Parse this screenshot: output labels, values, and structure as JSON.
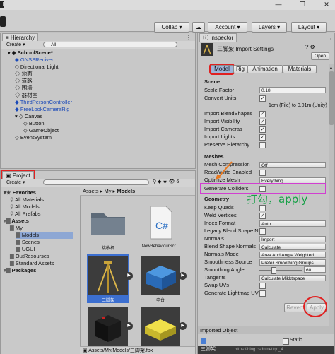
{
  "window": {
    "minimize": "—",
    "maximize": "❐",
    "close": "✕"
  },
  "toolbar": {
    "collab": "Collab ▾",
    "cloud": "☁",
    "account": "Account ▾",
    "layers": "Layers ▾",
    "layout": "Layout ▾"
  },
  "hierarchy": {
    "tab": "Hierarchy",
    "create": "Create ▾",
    "search_placeholder": "All",
    "scene": "SchoolScene*",
    "items": [
      {
        "label": "GNSSReciver",
        "blue": true,
        "indent": 1
      },
      {
        "label": "Directional Light",
        "blue": false,
        "indent": 1
      },
      {
        "label": "地面",
        "blue": false,
        "indent": 1
      },
      {
        "label": "道路",
        "blue": false,
        "indent": 1
      },
      {
        "label": "围墙",
        "blue": false,
        "indent": 1
      },
      {
        "label": "器材室",
        "blue": false,
        "indent": 1
      },
      {
        "label": "ThirdPersonController",
        "blue": true,
        "indent": 1
      },
      {
        "label": "FreeLookCameraRig",
        "blue": true,
        "indent": 1
      },
      {
        "label": "Canvas",
        "blue": false,
        "indent": 1
      },
      {
        "label": "Button",
        "blue": false,
        "indent": 2
      },
      {
        "label": "GameObject",
        "blue": false,
        "indent": 2
      },
      {
        "label": "EventSystem",
        "blue": false,
        "indent": 1
      }
    ]
  },
  "project": {
    "tab": "Project",
    "create": "Create ▾",
    "breadcrumb": [
      "Assets",
      "My",
      "Models"
    ],
    "tree": [
      {
        "label": "Favorites",
        "bold": true,
        "indent": 0
      },
      {
        "label": "All Materials",
        "bold": false,
        "indent": 1
      },
      {
        "label": "All Models",
        "bold": false,
        "indent": 1
      },
      {
        "label": "All Prefabs",
        "bold": false,
        "indent": 1
      },
      {
        "label": "Assets",
        "bold": true,
        "indent": 0
      },
      {
        "label": "My",
        "bold": false,
        "indent": 1
      },
      {
        "label": "Models",
        "bold": false,
        "indent": 2,
        "selected": true
      },
      {
        "label": "Scenes",
        "bold": false,
        "indent": 2
      },
      {
        "label": "UGUI",
        "bold": false,
        "indent": 2
      },
      {
        "label": "OutResourses",
        "bold": false,
        "indent": 1
      },
      {
        "label": "Standard Assets",
        "bold": false,
        "indent": 1
      },
      {
        "label": "Packages",
        "bold": true,
        "indent": 0
      }
    ],
    "assets": [
      {
        "label": "接收机",
        "kind": "folder"
      },
      {
        "label": "NewBehaviourScr...",
        "kind": "script"
      },
      {
        "label": "三脚架",
        "kind": "tripod"
      },
      {
        "label": "电台",
        "kind": "bluebox"
      },
      {
        "label": "",
        "kind": "battery"
      },
      {
        "label": "",
        "kind": "yellowbox"
      }
    ],
    "status_path": "Assets/My/Models/三脚架.fbx"
  },
  "inspector": {
    "tab": "Inspector",
    "asset_name": "三脚架 Import Settings",
    "open": "Open",
    "tabs": [
      "Model",
      "Rig",
      "Animation",
      "Materials"
    ],
    "scene_header": "Scene",
    "scale_factor_label": "Scale Factor",
    "scale_factor": "0.18",
    "convert_units_label": "Convert Units",
    "convert_units_note": "1cm (File) to 0.01m (Unity)",
    "checks_scene": [
      {
        "label": "Import BlendShapes",
        "checked": true
      },
      {
        "label": "Import Visibility",
        "checked": true
      },
      {
        "label": "Import Cameras",
        "checked": true
      },
      {
        "label": "Import Lights",
        "checked": true
      },
      {
        "label": "Preserve Hierarchy",
        "checked": false
      }
    ],
    "meshes_header": "Meshes",
    "mesh_compression_label": "Mesh Compression",
    "mesh_compression": "Off",
    "readwrite_label": "Read/Write Enabled",
    "optimize_label": "Optimize Mesh",
    "optimize": "Everything",
    "generate_colliders_label": "Generate Colliders",
    "geometry_header": "Geometry",
    "geometry_checks": [
      {
        "label": "Keep Quads",
        "checked": false
      },
      {
        "label": "Weld Vertices",
        "checked": true
      }
    ],
    "index_format_label": "Index Format",
    "index_format": "Auto",
    "legacy_label": "Legacy Blend Shape N",
    "normals_label": "Normals",
    "normals": "Import",
    "blend_normals_label": "Blend Shape Normals",
    "blend_normals": "Calculate",
    "normals_mode_label": "Normals Mode",
    "normals_mode": "Area And Angle Weighted",
    "smoothness_label": "Smoothness Source",
    "smoothness": "Prefer Smoothing Groups",
    "smoothing_angle_label": "Smoothing Angle",
    "smoothing_angle": "60",
    "smoothing_fraction": 0.33,
    "tangents_label": "Tangents",
    "tangents": "Calculate Mikktspace",
    "swap_uvs_label": "Swap UVs",
    "lightmap_label": "Generate Lightmap UV",
    "revert": "Revert",
    "apply": "Apply",
    "imported_object": "Imported Object",
    "footer_name": "三脚架",
    "footer_static": "Static",
    "annotation": "打勾，apply",
    "watermark": "https://blog.csdn.net/qq_4..."
  },
  "colors": {
    "accent_red": "#e02020",
    "magenta": "#d13fd1",
    "annotation_green": "#18a048",
    "link_blue": "#1a49b8"
  }
}
